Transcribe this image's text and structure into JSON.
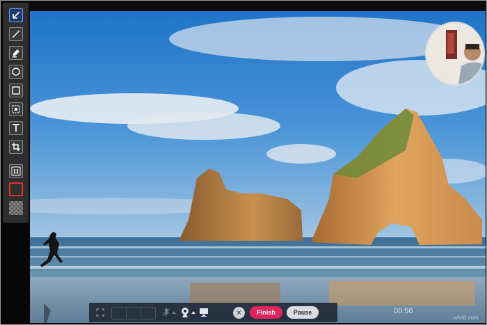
{
  "toolbar": {
    "tools": [
      {
        "name": "arrow-tool",
        "icon": "arrow-down-left-icon",
        "selected": true
      },
      {
        "name": "line-tool",
        "icon": "line-icon"
      },
      {
        "name": "highlighter-tool",
        "icon": "marker-icon"
      },
      {
        "name": "ellipse-tool",
        "icon": "circle-icon"
      },
      {
        "name": "rectangle-tool",
        "icon": "square-icon"
      },
      {
        "name": "selection-tool",
        "icon": "marquee-icon"
      },
      {
        "name": "text-tool",
        "icon": "text-icon",
        "label": "T"
      },
      {
        "name": "crop-tool",
        "icon": "crop-icon"
      },
      {
        "name": "step-tool",
        "icon": "numbered-step-icon"
      },
      {
        "name": "color-picker",
        "icon": "color-swatch-icon",
        "color": "#e0302a"
      },
      {
        "name": "fill-picker",
        "icon": "checker-swatch-icon"
      }
    ]
  },
  "controls": {
    "cancel_label": "×",
    "finish_label": "Finish",
    "pause_label": "Pause",
    "timer": "00:56"
  },
  "watermark": "wtvid.com",
  "colors": {
    "finish": "#e0245e",
    "selection_border": "#e0302a"
  }
}
